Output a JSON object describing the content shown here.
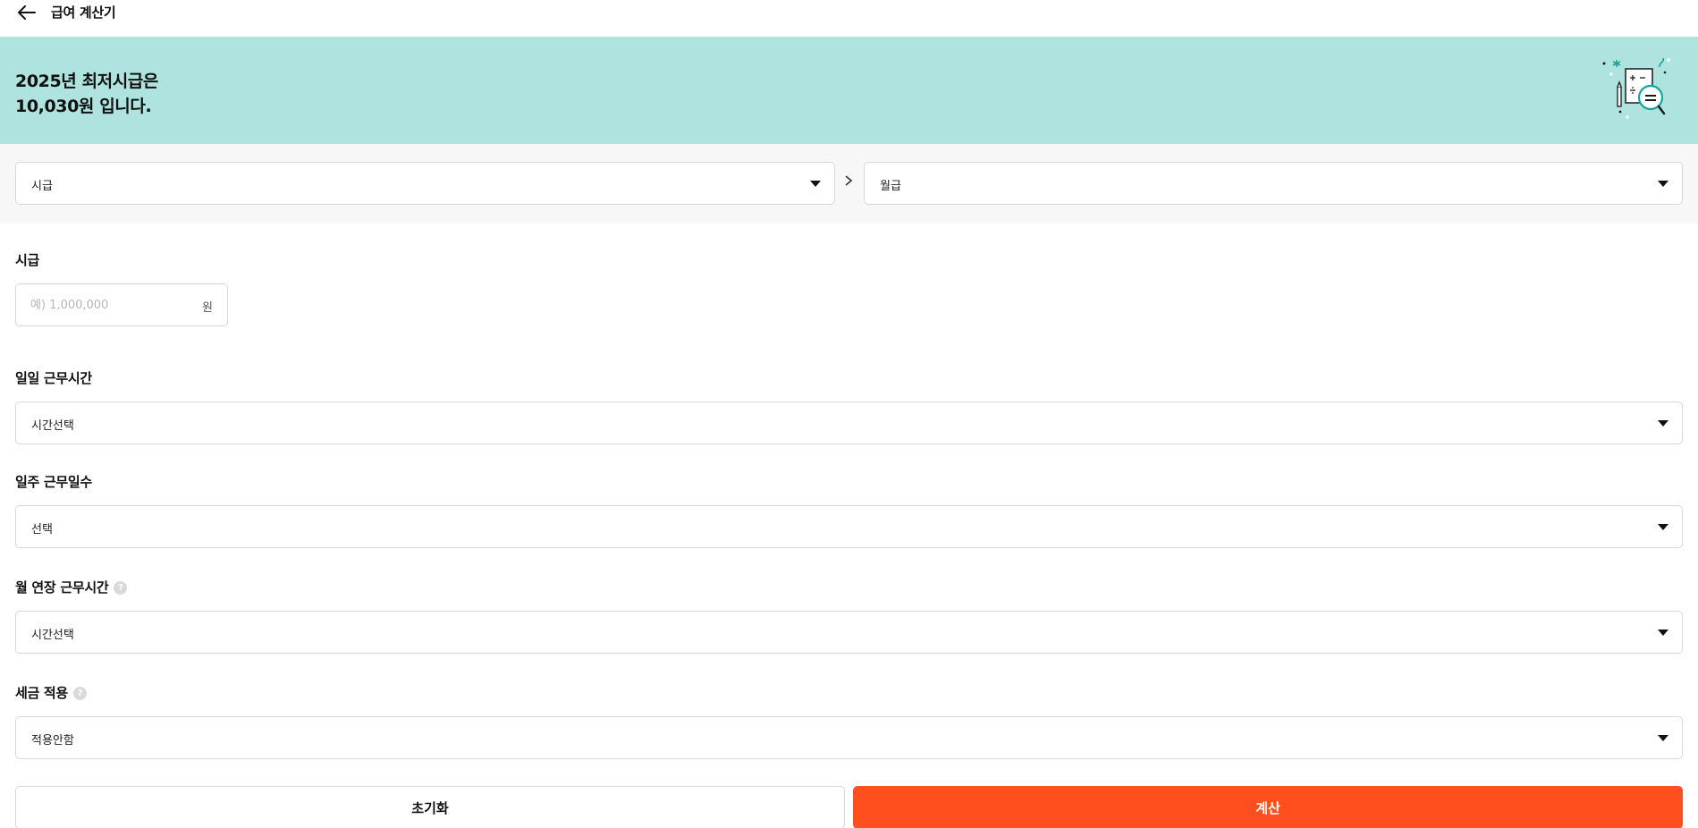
{
  "header": {
    "title": "급여 계산기",
    "back_icon": "arrow-left-icon"
  },
  "banner": {
    "line1": "2025년 최저시급은",
    "line2": "10,030원 입니다.",
    "background": "#afe3df",
    "illustration_icon": "calculator-magnifier-icon"
  },
  "conversion": {
    "from_value": "시급",
    "to_value": "월급",
    "separator_icon": "chevron-right-icon"
  },
  "form": {
    "wage": {
      "label": "시급",
      "placeholder": "예) 1,000,000",
      "unit": "원"
    },
    "daily_hours": {
      "label": "일일 근무시간",
      "value": "시간선택"
    },
    "weekly_days": {
      "label": "일주 근무일수",
      "value": "선택"
    },
    "monthly_overtime": {
      "label": "월 연장 근무시간",
      "value": "시간선택"
    },
    "tax": {
      "label": "세금 적용",
      "value": "적용안함"
    }
  },
  "actions": {
    "reset_label": "초기화",
    "calculate_label": "계산",
    "accent": "#ff4f1f"
  }
}
